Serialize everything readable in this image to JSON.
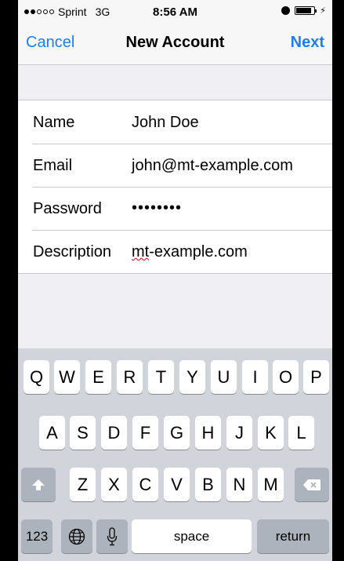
{
  "status_bar": {
    "carrier": "Sprint",
    "network": "3G",
    "time": "8:56 AM"
  },
  "nav": {
    "cancel": "Cancel",
    "title": "New Account",
    "next": "Next"
  },
  "form": {
    "name_label": "Name",
    "name_value": "John Doe",
    "email_label": "Email",
    "email_value": "john@mt-example.com",
    "password_label": "Password",
    "password_value": "••••••••",
    "description_label": "Description",
    "description_value_prefix": "mt",
    "description_value_suffix": "-example.com"
  },
  "keyboard": {
    "row1": [
      "Q",
      "W",
      "E",
      "R",
      "T",
      "Y",
      "U",
      "I",
      "O",
      "P"
    ],
    "row2": [
      "A",
      "S",
      "D",
      "F",
      "G",
      "H",
      "J",
      "K",
      "L"
    ],
    "row3": [
      "Z",
      "X",
      "C",
      "V",
      "B",
      "N",
      "M"
    ],
    "numbers": "123",
    "space": "space",
    "return": "return"
  },
  "icons": {
    "shift": "shift-icon",
    "delete": "delete-icon",
    "globe": "globe-icon",
    "microphone": "microphone-icon"
  },
  "colors": {
    "accent": "#1f7ee8",
    "keyboard_bg": "#d1d5db",
    "dark_key": "#adb3bc"
  }
}
